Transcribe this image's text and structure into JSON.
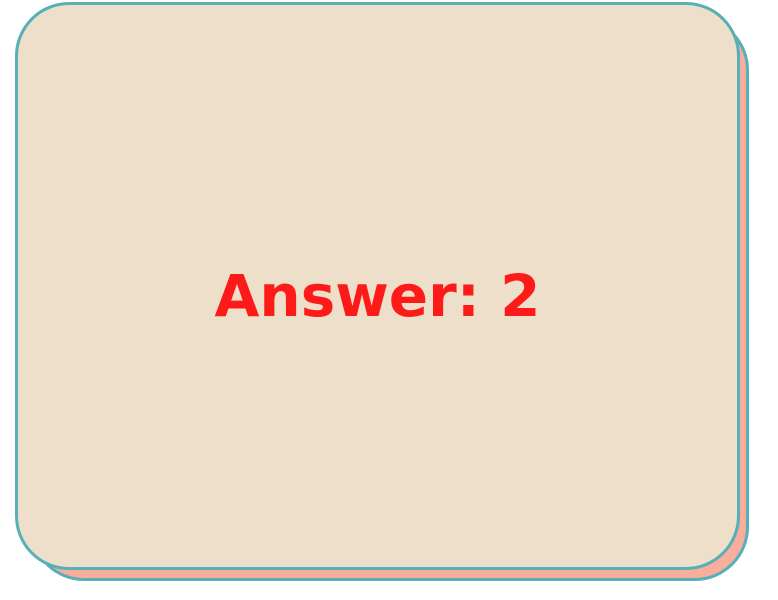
{
  "card": {
    "text": "Answer: 2"
  },
  "colors": {
    "card_fill": "#eddfc9",
    "shadow_fill": "#f8ad9d",
    "border": "#56b0b6",
    "text": "#ff1a1a"
  }
}
